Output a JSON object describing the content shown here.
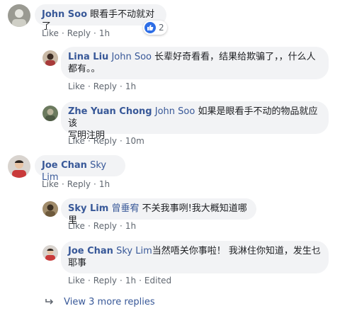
{
  "comments": [
    {
      "author": "John Soo",
      "mention": "",
      "text": "眼看手不动就对了",
      "actions": {
        "like": "Like",
        "reply": "Reply",
        "time": "1h",
        "edited": ""
      },
      "reactions": {
        "count": "2",
        "icon": "like-icon"
      },
      "replies": [
        {
          "author": "Lina Liu",
          "mention": "John Soo",
          "text_line1": "长辈好奇看看，结果给欺骗了，，什么人",
          "text_line2": "都有。。",
          "actions": {
            "like": "Like",
            "reply": "Reply",
            "time": "1h"
          }
        },
        {
          "author": "Zhe Yuan Chong",
          "mention": "John Soo",
          "text_line1": "如果是眼看手不动的物品就应该",
          "text_line2": "写明注明",
          "actions": {
            "like": "Like",
            "reply": "Reply",
            "time": "10m"
          }
        }
      ]
    },
    {
      "author": "Joe Chan",
      "mention": "Sky Lim",
      "text": "",
      "actions": {
        "like": "Like",
        "reply": "Reply",
        "time": "1h"
      },
      "replies": [
        {
          "author": "Sky Lim",
          "mention": "曾垂宥",
          "text_line1": "不关我事咧!我大概知道哪里",
          "actions": {
            "like": "Like",
            "reply": "Reply",
            "time": "1h"
          }
        },
        {
          "author": "Joe Chan",
          "mention": "Sky Lim",
          "text_line1": "当然唔关你事啦！ 我淋住你知道，发生乜",
          "text_line2": "耶事",
          "actions": {
            "like": "Like",
            "reply": "Reply",
            "time": "1h",
            "edited": "Edited"
          }
        }
      ],
      "more_replies": "View 3 more replies"
    }
  ],
  "separator": "·"
}
